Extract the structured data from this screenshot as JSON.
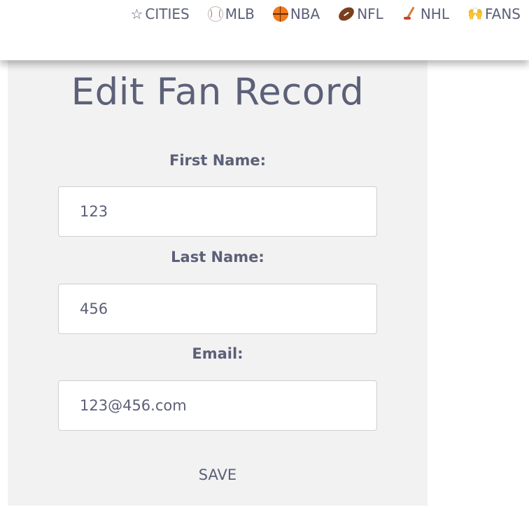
{
  "nav": {
    "items": [
      {
        "label": "CITIES",
        "icon": "star-icon"
      },
      {
        "label": "MLB",
        "icon": "baseball-icon"
      },
      {
        "label": "NBA",
        "icon": "basketball-icon"
      },
      {
        "label": "NFL",
        "icon": "football-icon"
      },
      {
        "label": "NHL",
        "icon": "hockey-stick-icon"
      },
      {
        "label": "FANS",
        "icon": "raising-hands-icon"
      }
    ]
  },
  "form": {
    "title": "Edit Fan Record",
    "first_name": {
      "label": "First Name:",
      "value": "123"
    },
    "last_name": {
      "label": "Last Name:",
      "value": "456"
    },
    "email": {
      "label": "Email:",
      "value": "123@456.com"
    },
    "save_label": "SAVE"
  },
  "colors": {
    "text": "#5c6078",
    "panel_background": "#f2f2f2",
    "input_border": "#cfcfcf"
  }
}
